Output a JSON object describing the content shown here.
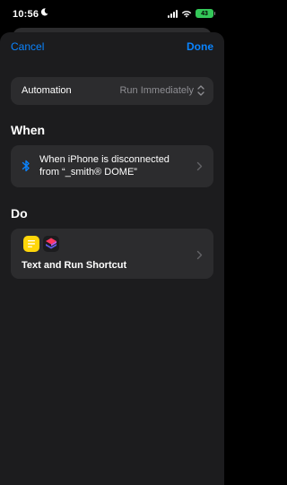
{
  "status": {
    "time": "10:56",
    "battery": "43"
  },
  "nav": {
    "cancel": "Cancel",
    "done": "Done"
  },
  "automation": {
    "label": "Automation",
    "value": "Run Immediately"
  },
  "when": {
    "title": "When",
    "line1": "When iPhone is disconnected",
    "line2": "from “_smith®  DOME”"
  },
  "do": {
    "title": "Do",
    "label": "Text and Run Shortcut"
  },
  "icons": {
    "bluetooth": "bluetooth-icon",
    "notes": "notes-app-icon",
    "shortcuts": "shortcuts-app-icon",
    "chevron": "chevron-right-icon",
    "updown": "chevron-up-down-icon"
  },
  "colors": {
    "accent": "#0a84ff",
    "sheet": "#1c1c1e",
    "card": "#2c2c2e",
    "secondary": "#8e8e93"
  }
}
